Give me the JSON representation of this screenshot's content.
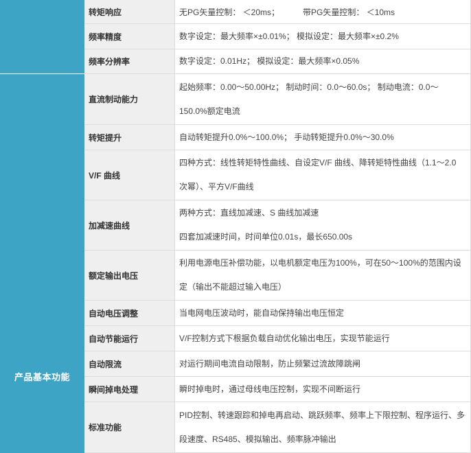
{
  "group": {
    "label": "产品基本功能"
  },
  "rows": [
    {
      "label": "转矩响应",
      "lines": [
        "无PG矢量控制： ＜20ms；",
        "带PG矢量控制： ＜10ms"
      ]
    },
    {
      "label": "频率精度",
      "lines": [
        "数字设定：最大频率×±0.01%； 模拟设定：最大频率×±0.2%"
      ]
    },
    {
      "label": "频率分辨率",
      "lines": [
        "数字设定：0.01Hz； 模拟设定：最大频率×0.05%"
      ]
    },
    {
      "label": "直流制动能力",
      "lines": [
        "起始频率：0.00～50.00Hz； 制动时间：0.0～60.0s； 制动电流：0.0～",
        "150.0%额定电流"
      ]
    },
    {
      "label": "转矩提升",
      "lines": [
        "自动转矩提升0.0%～100.0%； 手动转矩提升0.0%～30.0%"
      ]
    },
    {
      "label": "V/F 曲线",
      "lines": [
        "四种方式：线性转矩特性曲线、自设定V/F 曲线、降转矩特性曲线（1.1～2.0",
        "次幂）、平方V/F曲线"
      ]
    },
    {
      "label": "加减速曲线",
      "lines": [
        "两种方式：直线加减速、S 曲线加减速",
        "四套加减速时间，时间单位0.01s，最长650.00s"
      ]
    },
    {
      "label": "额定输出电压",
      "lines": [
        "利用电源电压补偿功能，以电机额定电压为100%，可在50～100%的范围内设",
        "定（输出不能超过输入电压）"
      ]
    },
    {
      "label": "自动电压调整",
      "lines": [
        "当电网电压波动时，能自动保持输出电压恒定"
      ]
    },
    {
      "label": "自动节能运行",
      "lines": [
        "V/F控制方式下根据负载自动优化输出电压，实现节能运行"
      ]
    },
    {
      "label": "自动限流",
      "lines": [
        "对运行期间电流自动限制，防止频繁过流故障跳闸"
      ]
    },
    {
      "label": "瞬间掉电处理",
      "lines": [
        "瞬时掉电时，通过母线电压控制，实现不间断运行"
      ]
    },
    {
      "label": "标准功能",
      "lines": [
        "PID控制、转速跟踪和掉电再启动、跳跃频率、频率上下限控制、程序运行、多",
        "段速度、RS485、模拟输出、频率脉冲输出"
      ]
    }
  ],
  "colors": {
    "group_bg": "#3ea4c6",
    "label_bg": "#efefef",
    "border": "#dcdcdc",
    "text": "#444444",
    "label_text": "#333333"
  }
}
